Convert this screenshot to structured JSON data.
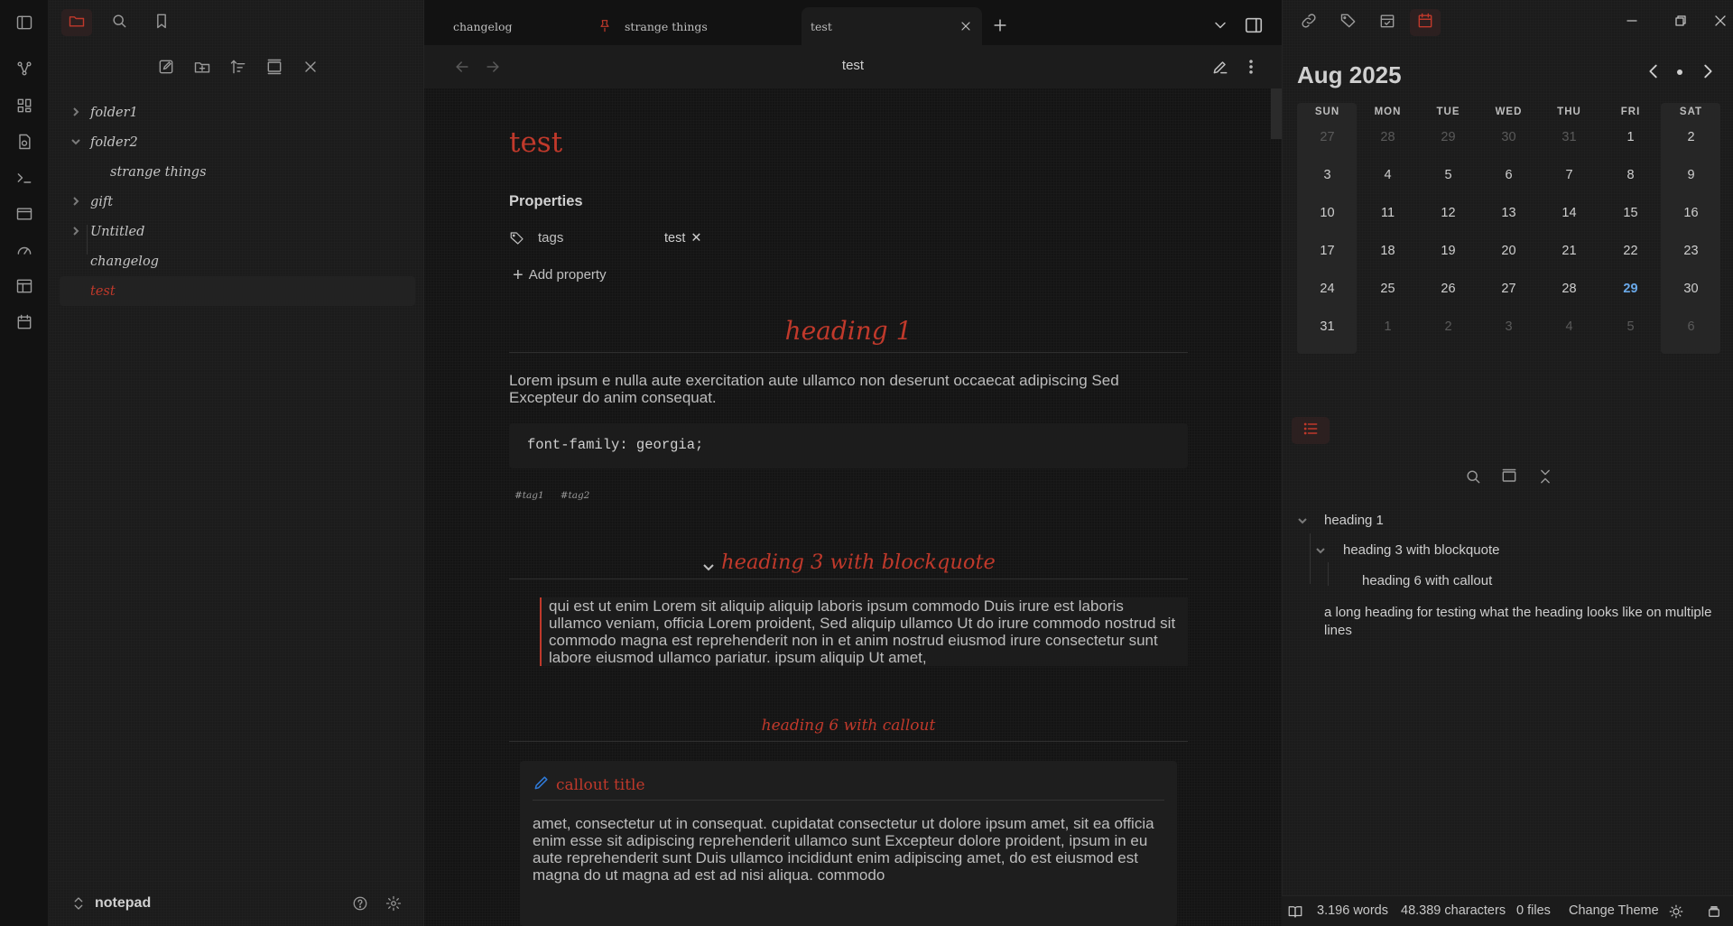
{
  "ribbon": {
    "icons": [
      "sidebar-toggle-icon",
      "graph-icon",
      "canvas-icon",
      "note-icon",
      "terminal-icon",
      "layout-icon",
      "dashboard-icon",
      "template-icon",
      "calendar-icon"
    ]
  },
  "left_sidebar": {
    "tree": [
      {
        "label": "folder1",
        "type": "folder",
        "expanded": false
      },
      {
        "label": "folder2",
        "type": "folder",
        "expanded": true
      },
      {
        "label": "strange things",
        "type": "file",
        "child": true
      },
      {
        "label": "gift",
        "type": "folder",
        "expanded": false
      },
      {
        "label": "Untitled",
        "type": "folder",
        "expanded": false
      },
      {
        "label": "changelog",
        "type": "file"
      },
      {
        "label": "test",
        "type": "file",
        "active": true
      }
    ],
    "vault_name": "notepad"
  },
  "tabs": [
    {
      "label": "changelog"
    },
    {
      "label": "strange things",
      "pinned": true
    },
    {
      "label": "test",
      "active": true
    }
  ],
  "view": {
    "title": "test"
  },
  "note": {
    "title": "test",
    "properties_heading": "Properties",
    "property_key": "tags",
    "property_value": "test",
    "add_property": "Add property",
    "heading1": "heading 1",
    "paragraph1": "Lorem ipsum e nulla aute exercitation aute ullamco non deserunt occaecat adipiscing Sed Excepteur do anim consequat.",
    "code": "font-family: georgia;",
    "tags": [
      "#tag1",
      "#tag2"
    ],
    "heading3": "heading 3 with blockquote",
    "blockquote": "qui est ut enim Lorem sit aliquip aliquip laboris ipsum commodo Duis irure est laboris ullamco veniam, officia Lorem proident, Sed aliquip ullamco Ut do irure commodo nostrud sit commodo magna est reprehenderit non in et anim nostrud eiusmod irure consectetur sunt labore eiusmod ullamco pariatur. ipsum aliquip Ut amet,",
    "heading6": "heading 6 with callout",
    "callout_title": "callout title",
    "callout_body": "amet, consectetur ut in consequat. cupidatat consectetur ut dolore ipsum amet, sit ea officia enim esse sit adipiscing reprehenderit ullamco sunt Excepteur dolore proident, ipsum in eu aute reprehenderit sunt Duis ullamco incididunt enim adipiscing amet, do est eiusmod est magna do ut magna ad est ad nisi aliqua. commodo"
  },
  "calendar": {
    "month_label": "Aug 2025",
    "weekdays": [
      "SUN",
      "MON",
      "TUE",
      "WED",
      "THU",
      "FRI",
      "SAT"
    ],
    "weeks": [
      [
        {
          "d": "27",
          "dim": true
        },
        {
          "d": "28",
          "dim": true
        },
        {
          "d": "29",
          "dim": true
        },
        {
          "d": "30",
          "dim": true
        },
        {
          "d": "31",
          "dim": true
        },
        {
          "d": "1"
        },
        {
          "d": "2"
        }
      ],
      [
        {
          "d": "3"
        },
        {
          "d": "4"
        },
        {
          "d": "5"
        },
        {
          "d": "6"
        },
        {
          "d": "7"
        },
        {
          "d": "8"
        },
        {
          "d": "9"
        }
      ],
      [
        {
          "d": "10"
        },
        {
          "d": "11"
        },
        {
          "d": "12"
        },
        {
          "d": "13"
        },
        {
          "d": "14"
        },
        {
          "d": "15"
        },
        {
          "d": "16"
        }
      ],
      [
        {
          "d": "17"
        },
        {
          "d": "18"
        },
        {
          "d": "19"
        },
        {
          "d": "20"
        },
        {
          "d": "21"
        },
        {
          "d": "22"
        },
        {
          "d": "23"
        }
      ],
      [
        {
          "d": "24"
        },
        {
          "d": "25"
        },
        {
          "d": "26"
        },
        {
          "d": "27"
        },
        {
          "d": "28"
        },
        {
          "d": "29",
          "today": true
        },
        {
          "d": "30"
        }
      ],
      [
        {
          "d": "31"
        },
        {
          "d": "1",
          "dim": true
        },
        {
          "d": "2",
          "dim": true
        },
        {
          "d": "3",
          "dim": true
        },
        {
          "d": "4",
          "dim": true
        },
        {
          "d": "5",
          "dim": true
        },
        {
          "d": "6",
          "dim": true
        }
      ]
    ]
  },
  "outline": {
    "items": [
      {
        "label": "heading 1",
        "level": 1,
        "collapsible": true
      },
      {
        "label": "heading 3 with blockquote",
        "level": 2,
        "collapsible": true
      },
      {
        "label": "heading 6 with callout",
        "level": 3
      },
      {
        "label": "a long heading for testing what the heading looks like on multiple lines",
        "level": 1
      }
    ]
  },
  "status": {
    "words": "3.196 words",
    "characters": "48.389 characters",
    "files": "0 files",
    "theme": "Change Theme"
  },
  "colors": {
    "accent": "#c0392b",
    "today": "#6aa9e9",
    "callout_icon": "#2f7ad8"
  }
}
